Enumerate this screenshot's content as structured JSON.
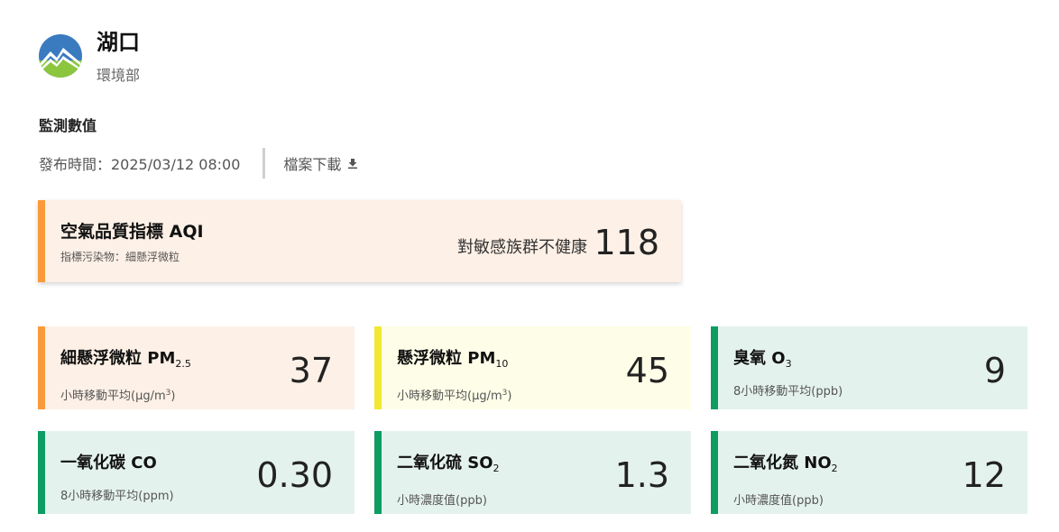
{
  "station": {
    "name": "湖口",
    "agency": "環境部"
  },
  "section": {
    "title": "監測數值"
  },
  "publish": {
    "time_label": "發布時間：2025/03/12 08:00",
    "download_label": "檔案下載"
  },
  "aqi": {
    "title": "空氣品質指標 AQI",
    "pollutant_label": "指標污染物：細懸浮微粒",
    "status": "對敏感族群不健康",
    "value": "118",
    "color": "#fb9a3b"
  },
  "cards": [
    {
      "name": "細懸浮微粒 PM",
      "sub": "2.5",
      "unit": "小時移動平均(μg/m",
      "unit_sup": "3",
      "unit_end": ")",
      "value": "37",
      "color": "#fb9a3b"
    },
    {
      "name": "懸浮微粒 PM",
      "sub": "10",
      "unit": "小時移動平均(μg/m",
      "unit_sup": "3",
      "unit_end": ")",
      "value": "45",
      "color": "#f2e832"
    },
    {
      "name": "臭氧 O",
      "sub": "3",
      "unit": "8小時移動平均(ppb)",
      "value": "9",
      "color": "#0d9d63"
    },
    {
      "name": "一氧化碳 CO",
      "unit": "8小時移動平均(ppm)",
      "value": "0.30",
      "color": "#0d9d63"
    },
    {
      "name": "二氧化硫 SO",
      "sub": "2",
      "unit": "小時濃度值(ppb)",
      "value": "1.3",
      "color": "#0d9d63"
    },
    {
      "name": "二氧化氮 NO",
      "sub": "2",
      "unit": "小時濃度值(ppb)",
      "value": "12",
      "color": "#0d9d63"
    }
  ],
  "icons": {
    "logo": "moenv-logo-icon",
    "download": "download-icon"
  }
}
